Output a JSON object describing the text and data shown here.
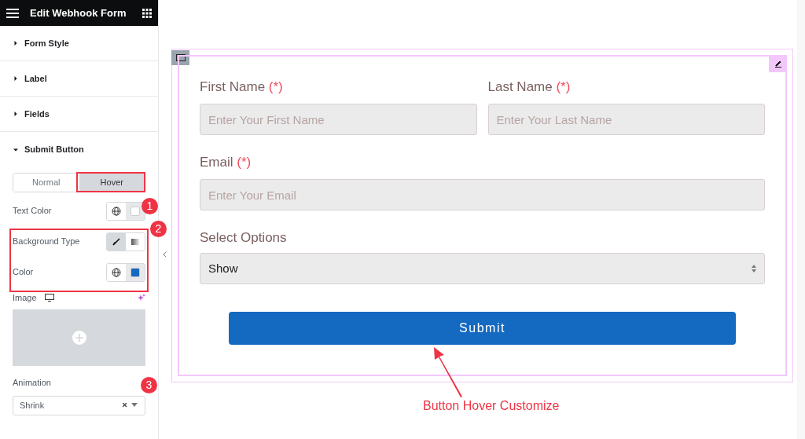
{
  "header": {
    "title": "Edit Webhook Form"
  },
  "sections": [
    {
      "label": "Form Style",
      "expanded": false
    },
    {
      "label": "Label",
      "expanded": false
    },
    {
      "label": "Fields",
      "expanded": false
    },
    {
      "label": "Submit Button",
      "expanded": true
    }
  ],
  "state_tabs": [
    {
      "label": "Normal",
      "selected": false
    },
    {
      "label": "Hover",
      "selected": true
    }
  ],
  "controls": [
    {
      "kind": "color",
      "label": "Text Color",
      "color": "#ffffff"
    },
    {
      "kind": "bgtype",
      "label": "Background Type",
      "options": [
        {
          "selected": true
        },
        {
          "selected": false
        }
      ]
    },
    {
      "kind": "color",
      "label": "Color",
      "color": "#1469c0"
    }
  ],
  "image": {
    "label": "Image"
  },
  "animation": {
    "label": "Animation",
    "value": "Shrink"
  },
  "form": {
    "fields": [
      {
        "label": "First Name",
        "required_mark": "(*)",
        "placeholder": "Enter Your First Name"
      },
      {
        "label": "Last Name",
        "required_mark": "(*)",
        "placeholder": "Enter Your Last Name"
      },
      {
        "label": "Email",
        "required_mark": "(*)",
        "placeholder": "Enter Your Email"
      }
    ],
    "select": {
      "label": "Select Options",
      "value": "Show"
    },
    "submit": "Submit"
  },
  "callouts": [
    "1",
    "2",
    "3"
  ],
  "caption": "Button Hover Customize"
}
